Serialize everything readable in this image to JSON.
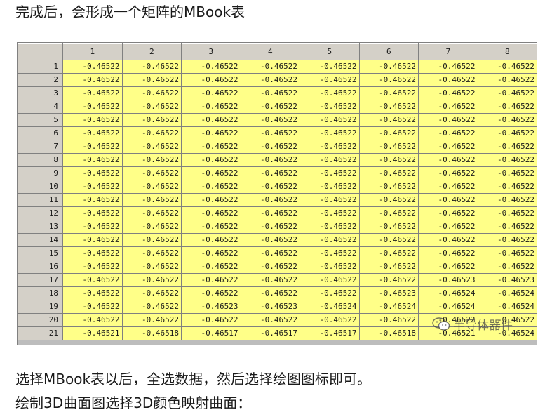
{
  "intro_text": "完成后，会形成一个矩阵的MBook表",
  "outro_text_1": "选择MBook表以后，全选数据，然后选择绘图图标即可。",
  "outro_text_2": "绘制3D曲面图选择3D颜色映射曲面：",
  "watermark_text": "半导体器件",
  "sheet": {
    "columns": [
      "1",
      "2",
      "3",
      "4",
      "5",
      "6",
      "7",
      "8"
    ],
    "rows": [
      {
        "label": "1",
        "cells": [
          "-0.46522",
          "-0.46522",
          "-0.46522",
          "-0.46522",
          "-0.46522",
          "-0.46522",
          "-0.46522",
          "-0.46522"
        ]
      },
      {
        "label": "2",
        "cells": [
          "-0.46522",
          "-0.46522",
          "-0.46522",
          "-0.46522",
          "-0.46522",
          "-0.46522",
          "-0.46522",
          "-0.46522"
        ]
      },
      {
        "label": "3",
        "cells": [
          "-0.46522",
          "-0.46522",
          "-0.46522",
          "-0.46522",
          "-0.46522",
          "-0.46522",
          "-0.46522",
          "-0.46522"
        ]
      },
      {
        "label": "4",
        "cells": [
          "-0.46522",
          "-0.46522",
          "-0.46522",
          "-0.46522",
          "-0.46522",
          "-0.46522",
          "-0.46522",
          "-0.46522"
        ]
      },
      {
        "label": "5",
        "cells": [
          "-0.46522",
          "-0.46522",
          "-0.46522",
          "-0.46522",
          "-0.46522",
          "-0.46522",
          "-0.46522",
          "-0.46522"
        ]
      },
      {
        "label": "6",
        "cells": [
          "-0.46522",
          "-0.46522",
          "-0.46522",
          "-0.46522",
          "-0.46522",
          "-0.46522",
          "-0.46522",
          "-0.46522"
        ]
      },
      {
        "label": "7",
        "cells": [
          "-0.46522",
          "-0.46522",
          "-0.46522",
          "-0.46522",
          "-0.46522",
          "-0.46522",
          "-0.46522",
          "-0.46522"
        ]
      },
      {
        "label": "8",
        "cells": [
          "-0.46522",
          "-0.46522",
          "-0.46522",
          "-0.46522",
          "-0.46522",
          "-0.46522",
          "-0.46522",
          "-0.46522"
        ]
      },
      {
        "label": "9",
        "cells": [
          "-0.46522",
          "-0.46522",
          "-0.46522",
          "-0.46522",
          "-0.46522",
          "-0.46522",
          "-0.46522",
          "-0.46522"
        ]
      },
      {
        "label": "10",
        "cells": [
          "-0.46522",
          "-0.46522",
          "-0.46522",
          "-0.46522",
          "-0.46522",
          "-0.46522",
          "-0.46522",
          "-0.46522"
        ]
      },
      {
        "label": "11",
        "cells": [
          "-0.46522",
          "-0.46522",
          "-0.46522",
          "-0.46522",
          "-0.46522",
          "-0.46522",
          "-0.46522",
          "-0.46522"
        ]
      },
      {
        "label": "12",
        "cells": [
          "-0.46522",
          "-0.46522",
          "-0.46522",
          "-0.46522",
          "-0.46522",
          "-0.46522",
          "-0.46522",
          "-0.46522"
        ]
      },
      {
        "label": "13",
        "cells": [
          "-0.46522",
          "-0.46522",
          "-0.46522",
          "-0.46522",
          "-0.46522",
          "-0.46522",
          "-0.46522",
          "-0.46522"
        ]
      },
      {
        "label": "14",
        "cells": [
          "-0.46522",
          "-0.46522",
          "-0.46522",
          "-0.46522",
          "-0.46522",
          "-0.46522",
          "-0.46522",
          "-0.46522"
        ]
      },
      {
        "label": "15",
        "cells": [
          "-0.46522",
          "-0.46522",
          "-0.46522",
          "-0.46522",
          "-0.46522",
          "-0.46522",
          "-0.46522",
          "-0.46522"
        ]
      },
      {
        "label": "16",
        "cells": [
          "-0.46522",
          "-0.46522",
          "-0.46522",
          "-0.46522",
          "-0.46522",
          "-0.46522",
          "-0.46522",
          "-0.46522"
        ]
      },
      {
        "label": "17",
        "cells": [
          "-0.46522",
          "-0.46522",
          "-0.46522",
          "-0.46522",
          "-0.46522",
          "-0.46522",
          "-0.46523",
          "-0.46523"
        ]
      },
      {
        "label": "18",
        "cells": [
          "-0.46522",
          "-0.46522",
          "-0.46522",
          "-0.46522",
          "-0.46522",
          "-0.46523",
          "-0.46524",
          "-0.46524"
        ]
      },
      {
        "label": "19",
        "cells": [
          "-0.46522",
          "-0.46522",
          "-0.46523",
          "-0.46523",
          "-0.46524",
          "-0.46524",
          "-0.46524",
          "-0.46524"
        ]
      },
      {
        "label": "20",
        "cells": [
          "-0.46522",
          "-0.46522",
          "-0.46522",
          "-0.46522",
          "-0.46522",
          "-0.46522",
          "-0.46522",
          "-0.46522"
        ]
      },
      {
        "label": "21",
        "cells": [
          "-0.46521",
          "-0.46518",
          "-0.46517",
          "-0.46517",
          "-0.46517",
          "-0.46518",
          "-0.46521",
          "-0.46524"
        ]
      }
    ]
  }
}
